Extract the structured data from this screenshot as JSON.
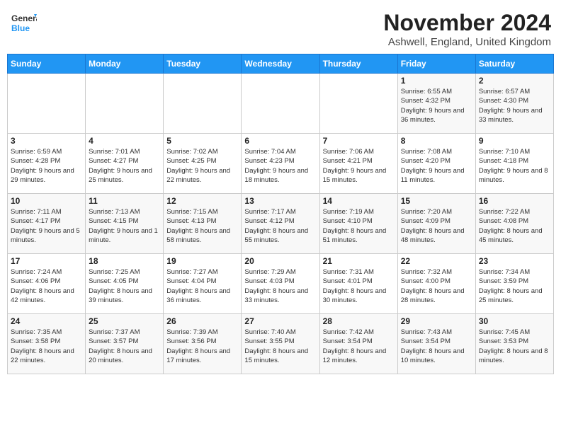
{
  "header": {
    "logo_general": "General",
    "logo_blue": "Blue",
    "main_title": "November 2024",
    "sub_title": "Ashwell, England, United Kingdom"
  },
  "columns": [
    "Sunday",
    "Monday",
    "Tuesday",
    "Wednesday",
    "Thursday",
    "Friday",
    "Saturday"
  ],
  "rows": [
    [
      {
        "day": "",
        "info": ""
      },
      {
        "day": "",
        "info": ""
      },
      {
        "day": "",
        "info": ""
      },
      {
        "day": "",
        "info": ""
      },
      {
        "day": "",
        "info": ""
      },
      {
        "day": "1",
        "info": "Sunrise: 6:55 AM\nSunset: 4:32 PM\nDaylight: 9 hours and 36 minutes."
      },
      {
        "day": "2",
        "info": "Sunrise: 6:57 AM\nSunset: 4:30 PM\nDaylight: 9 hours and 33 minutes."
      }
    ],
    [
      {
        "day": "3",
        "info": "Sunrise: 6:59 AM\nSunset: 4:28 PM\nDaylight: 9 hours and 29 minutes."
      },
      {
        "day": "4",
        "info": "Sunrise: 7:01 AM\nSunset: 4:27 PM\nDaylight: 9 hours and 25 minutes."
      },
      {
        "day": "5",
        "info": "Sunrise: 7:02 AM\nSunset: 4:25 PM\nDaylight: 9 hours and 22 minutes."
      },
      {
        "day": "6",
        "info": "Sunrise: 7:04 AM\nSunset: 4:23 PM\nDaylight: 9 hours and 18 minutes."
      },
      {
        "day": "7",
        "info": "Sunrise: 7:06 AM\nSunset: 4:21 PM\nDaylight: 9 hours and 15 minutes."
      },
      {
        "day": "8",
        "info": "Sunrise: 7:08 AM\nSunset: 4:20 PM\nDaylight: 9 hours and 11 minutes."
      },
      {
        "day": "9",
        "info": "Sunrise: 7:10 AM\nSunset: 4:18 PM\nDaylight: 9 hours and 8 minutes."
      }
    ],
    [
      {
        "day": "10",
        "info": "Sunrise: 7:11 AM\nSunset: 4:17 PM\nDaylight: 9 hours and 5 minutes."
      },
      {
        "day": "11",
        "info": "Sunrise: 7:13 AM\nSunset: 4:15 PM\nDaylight: 9 hours and 1 minute."
      },
      {
        "day": "12",
        "info": "Sunrise: 7:15 AM\nSunset: 4:13 PM\nDaylight: 8 hours and 58 minutes."
      },
      {
        "day": "13",
        "info": "Sunrise: 7:17 AM\nSunset: 4:12 PM\nDaylight: 8 hours and 55 minutes."
      },
      {
        "day": "14",
        "info": "Sunrise: 7:19 AM\nSunset: 4:10 PM\nDaylight: 8 hours and 51 minutes."
      },
      {
        "day": "15",
        "info": "Sunrise: 7:20 AM\nSunset: 4:09 PM\nDaylight: 8 hours and 48 minutes."
      },
      {
        "day": "16",
        "info": "Sunrise: 7:22 AM\nSunset: 4:08 PM\nDaylight: 8 hours and 45 minutes."
      }
    ],
    [
      {
        "day": "17",
        "info": "Sunrise: 7:24 AM\nSunset: 4:06 PM\nDaylight: 8 hours and 42 minutes."
      },
      {
        "day": "18",
        "info": "Sunrise: 7:25 AM\nSunset: 4:05 PM\nDaylight: 8 hours and 39 minutes."
      },
      {
        "day": "19",
        "info": "Sunrise: 7:27 AM\nSunset: 4:04 PM\nDaylight: 8 hours and 36 minutes."
      },
      {
        "day": "20",
        "info": "Sunrise: 7:29 AM\nSunset: 4:03 PM\nDaylight: 8 hours and 33 minutes."
      },
      {
        "day": "21",
        "info": "Sunrise: 7:31 AM\nSunset: 4:01 PM\nDaylight: 8 hours and 30 minutes."
      },
      {
        "day": "22",
        "info": "Sunrise: 7:32 AM\nSunset: 4:00 PM\nDaylight: 8 hours and 28 minutes."
      },
      {
        "day": "23",
        "info": "Sunrise: 7:34 AM\nSunset: 3:59 PM\nDaylight: 8 hours and 25 minutes."
      }
    ],
    [
      {
        "day": "24",
        "info": "Sunrise: 7:35 AM\nSunset: 3:58 PM\nDaylight: 8 hours and 22 minutes."
      },
      {
        "day": "25",
        "info": "Sunrise: 7:37 AM\nSunset: 3:57 PM\nDaylight: 8 hours and 20 minutes."
      },
      {
        "day": "26",
        "info": "Sunrise: 7:39 AM\nSunset: 3:56 PM\nDaylight: 8 hours and 17 minutes."
      },
      {
        "day": "27",
        "info": "Sunrise: 7:40 AM\nSunset: 3:55 PM\nDaylight: 8 hours and 15 minutes."
      },
      {
        "day": "28",
        "info": "Sunrise: 7:42 AM\nSunset: 3:54 PM\nDaylight: 8 hours and 12 minutes."
      },
      {
        "day": "29",
        "info": "Sunrise: 7:43 AM\nSunset: 3:54 PM\nDaylight: 8 hours and 10 minutes."
      },
      {
        "day": "30",
        "info": "Sunrise: 7:45 AM\nSunset: 3:53 PM\nDaylight: 8 hours and 8 minutes."
      }
    ]
  ]
}
